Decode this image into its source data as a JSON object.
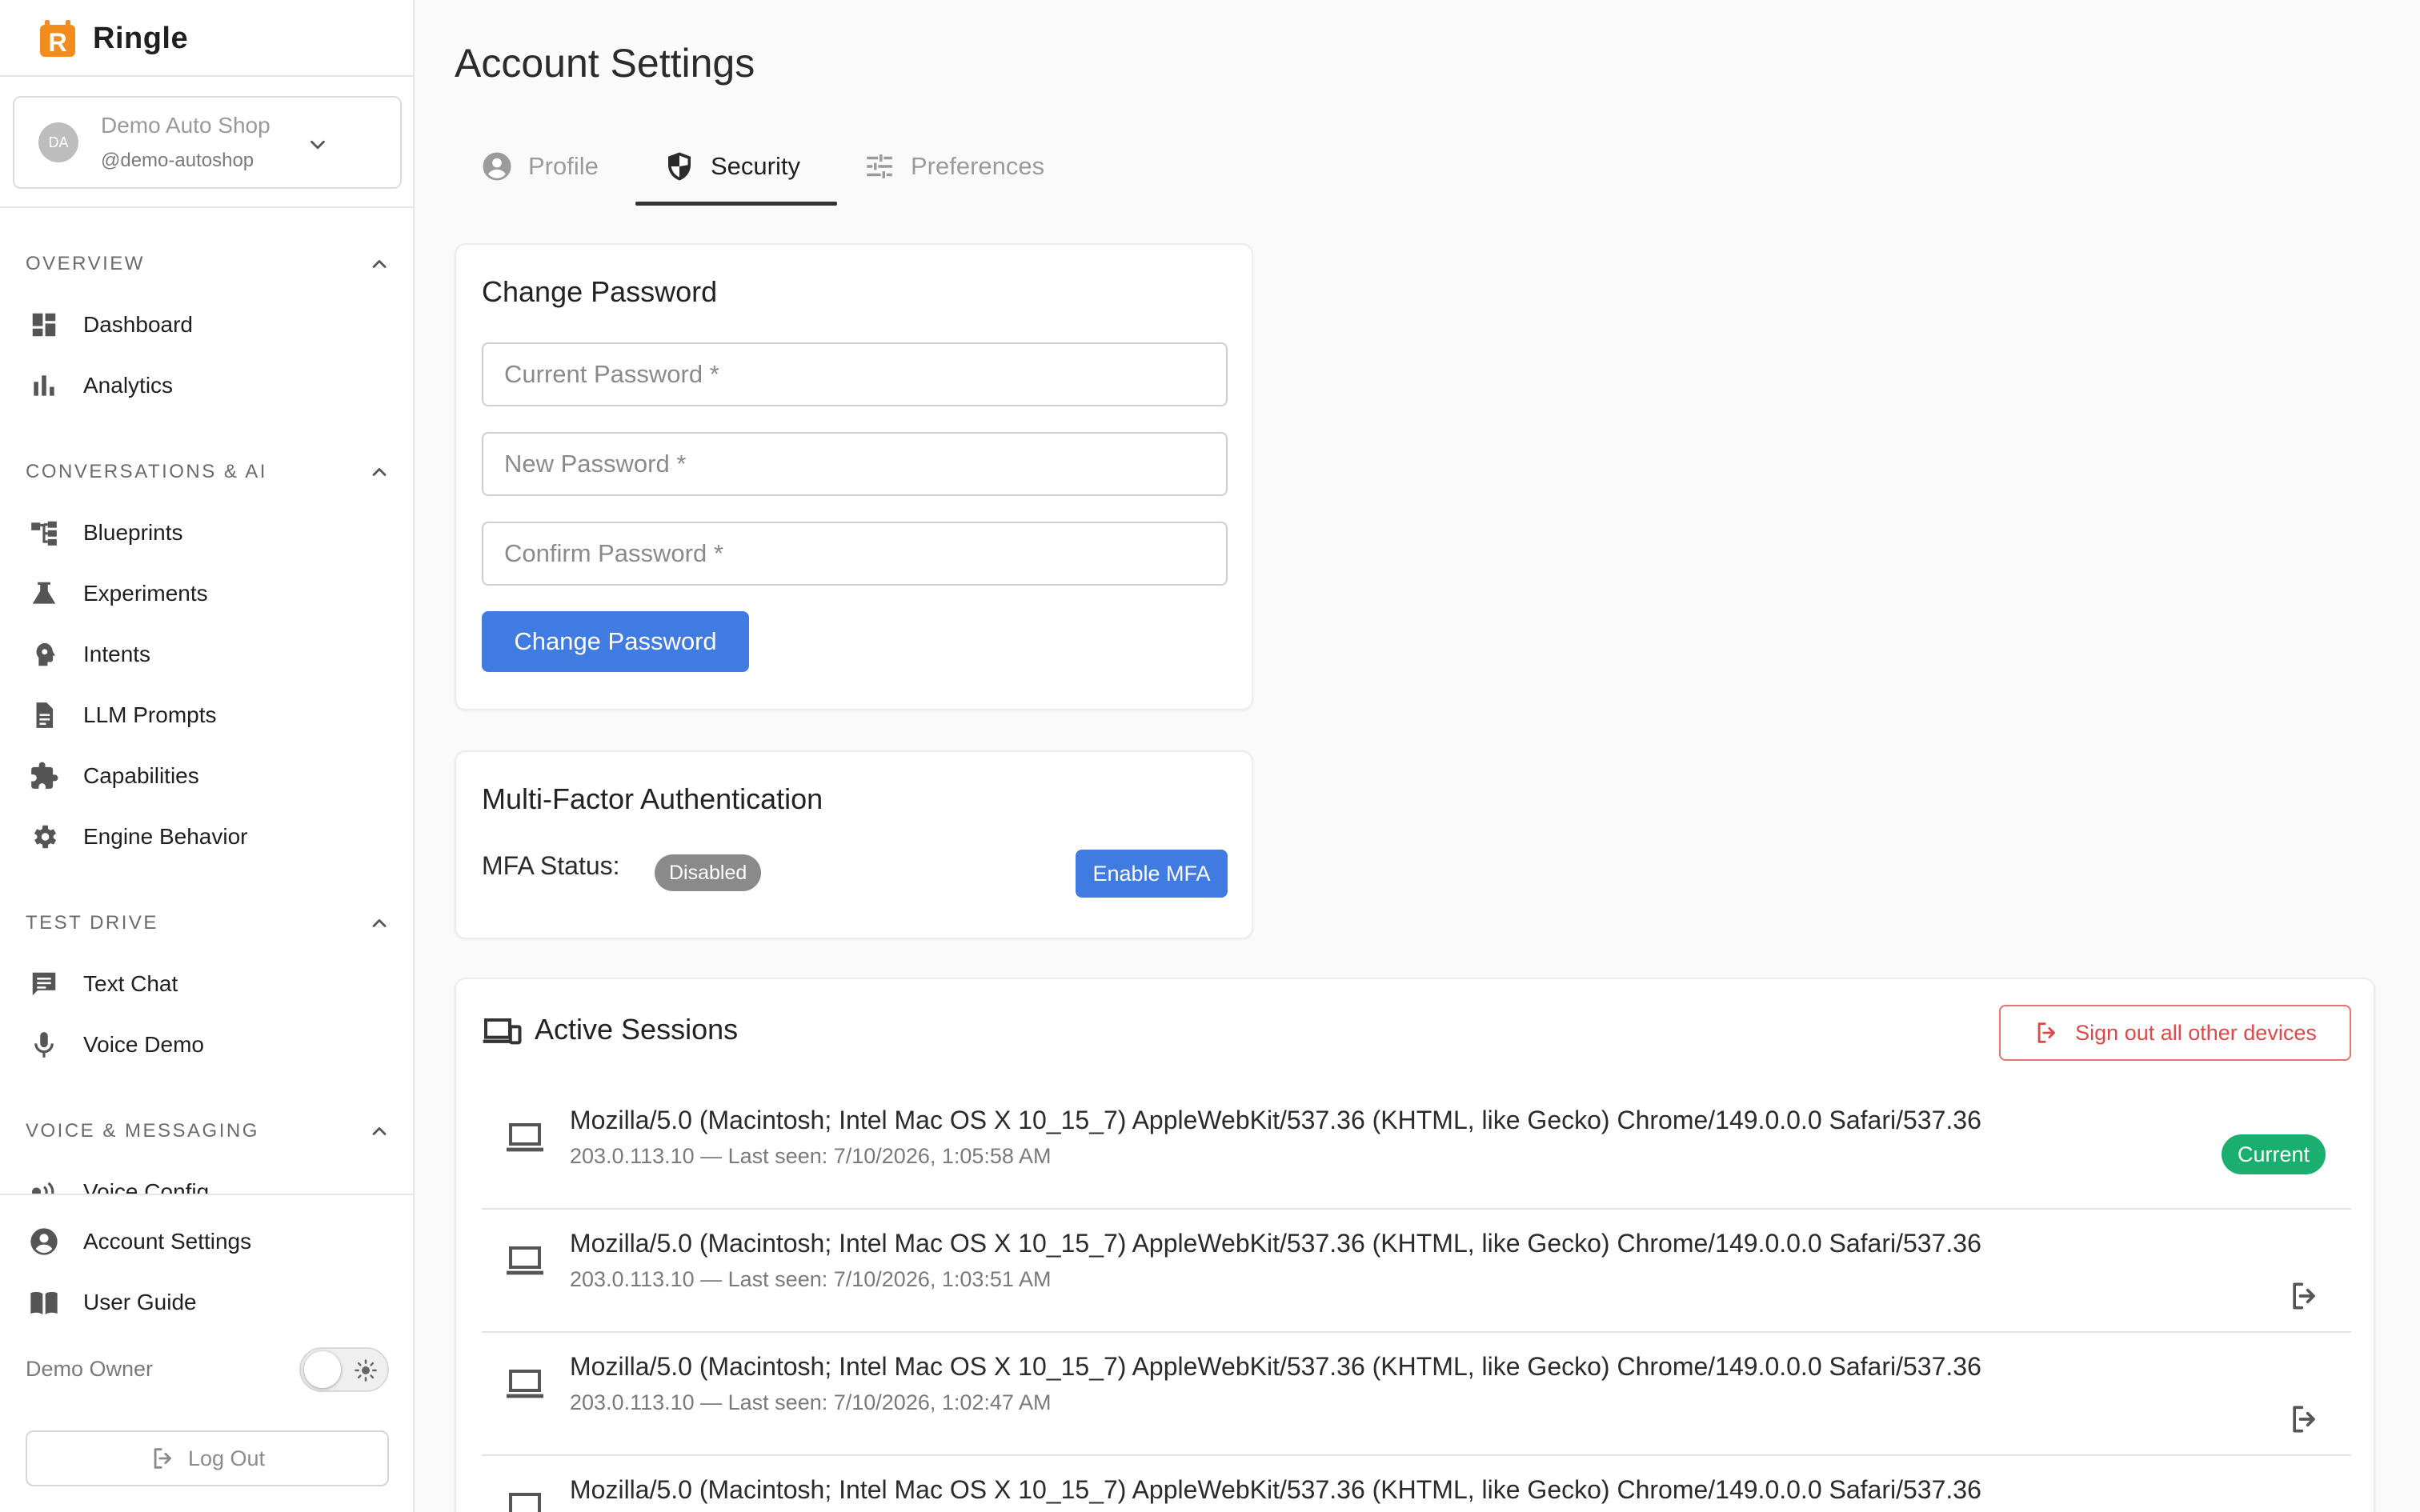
{
  "app": {
    "name": "Ringle"
  },
  "org": {
    "avatar_initials": "DA",
    "name": "Demo Auto Shop",
    "handle": "@demo-autoshop"
  },
  "sidebar": {
    "sections": [
      {
        "title": "OVERVIEW",
        "items": [
          {
            "label": "Dashboard",
            "icon": "dashboard-icon"
          },
          {
            "label": "Analytics",
            "icon": "bar-chart-icon"
          }
        ]
      },
      {
        "title": "CONVERSATIONS & AI",
        "items": [
          {
            "label": "Blueprints",
            "icon": "flow-tree-icon"
          },
          {
            "label": "Experiments",
            "icon": "flask-icon"
          },
          {
            "label": "Intents",
            "icon": "psychology-head-icon"
          },
          {
            "label": "LLM Prompts",
            "icon": "document-icon"
          },
          {
            "label": "Capabilities",
            "icon": "puzzle-icon"
          },
          {
            "label": "Engine Behavior",
            "icon": "gear-icon"
          }
        ]
      },
      {
        "title": "TEST DRIVE",
        "items": [
          {
            "label": "Text Chat",
            "icon": "chat-icon"
          },
          {
            "label": "Voice Demo",
            "icon": "microphone-icon"
          }
        ]
      },
      {
        "title": "VOICE & MESSAGING",
        "items": [
          {
            "label": "Voice Config",
            "icon": "voice-waves-icon"
          }
        ]
      }
    ],
    "bottom": {
      "account_settings": "Account Settings",
      "user_guide": "User Guide",
      "user_name": "Demo Owner",
      "logout": "Log Out"
    }
  },
  "page": {
    "title": "Account Settings",
    "tabs": [
      {
        "label": "Profile",
        "active": false
      },
      {
        "label": "Security",
        "active": true
      },
      {
        "label": "Preferences",
        "active": false
      }
    ]
  },
  "change_password": {
    "title": "Change Password",
    "current_placeholder": "Current Password *",
    "new_placeholder": "New Password *",
    "confirm_placeholder": "Confirm Password *",
    "submit": "Change Password"
  },
  "mfa": {
    "title": "Multi-Factor Authentication",
    "status_label": "MFA Status:",
    "status": "Disabled",
    "enable_button": "Enable MFA"
  },
  "sessions": {
    "title": "Active Sessions",
    "sign_out_all": "Sign out all other devices",
    "current_badge": "Current",
    "items": [
      {
        "user_agent": "Mozilla/5.0 (Macintosh; Intel Mac OS X 10_15_7) AppleWebKit/537.36 (KHTML, like Gecko) Chrome/149.0.0.0 Safari/537.36",
        "meta": "203.0.113.10 — Last seen: 7/10/2026, 1:05:58 AM",
        "current": true
      },
      {
        "user_agent": "Mozilla/5.0 (Macintosh; Intel Mac OS X 10_15_7) AppleWebKit/537.36 (KHTML, like Gecko) Chrome/149.0.0.0 Safari/537.36",
        "meta": "203.0.113.10 — Last seen: 7/10/2026, 1:03:51 AM",
        "current": false
      },
      {
        "user_agent": "Mozilla/5.0 (Macintosh; Intel Mac OS X 10_15_7) AppleWebKit/537.36 (KHTML, like Gecko) Chrome/149.0.0.0 Safari/537.36",
        "meta": "203.0.113.10 — Last seen: 7/10/2026, 1:02:47 AM",
        "current": false
      },
      {
        "user_agent": "Mozilla/5.0 (Macintosh; Intel Mac OS X 10_15_7) AppleWebKit/537.36 (KHTML, like Gecko) Chrome/149.0.0.0 Safari/537.36",
        "meta": "",
        "current": false
      }
    ]
  },
  "colors": {
    "brand_orange": "#f28c1e",
    "primary_blue": "#3f7be0",
    "danger_red": "#e04848",
    "success_green": "#1aae6f",
    "badge_gray": "#8a8a8a"
  }
}
